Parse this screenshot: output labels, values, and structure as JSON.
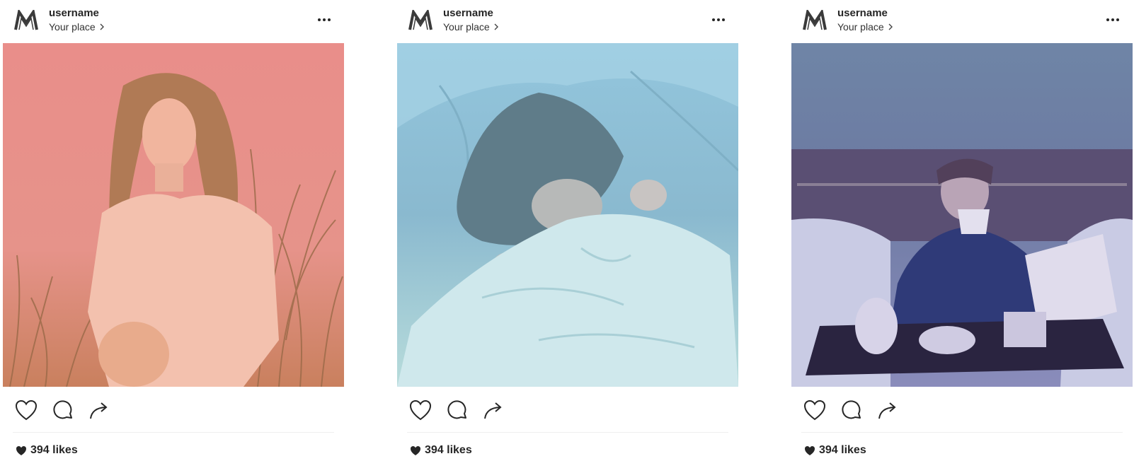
{
  "colors": {
    "post1_overlay": "#f48a86",
    "post2_overlay": "#8fc6dc",
    "post3_overlay": "#6b7ba8",
    "text": "#262626"
  },
  "posts": [
    {
      "username": "username",
      "place": "Your place",
      "likes_text": "394 likes",
      "photo_subject": "woman in knit sweater sitting in tall grass",
      "avatar_icon": "m-logo-icon"
    },
    {
      "username": "username",
      "place": "Your place",
      "likes_text": "394 likes",
      "photo_subject": "person hiding under white bed sheets",
      "avatar_icon": "m-logo-icon"
    },
    {
      "username": "username",
      "place": "Your place",
      "likes_text": "394 likes",
      "photo_subject": "man in robe drinking coffee in bed with breakfast tray",
      "avatar_icon": "m-logo-icon"
    }
  ],
  "icons": {
    "more": "more-options-icon",
    "like": "heart-icon",
    "comment": "comment-icon",
    "share": "share-arrow-icon",
    "chevron": "chevron-right-icon",
    "likes_heart": "filled-heart-icon"
  }
}
